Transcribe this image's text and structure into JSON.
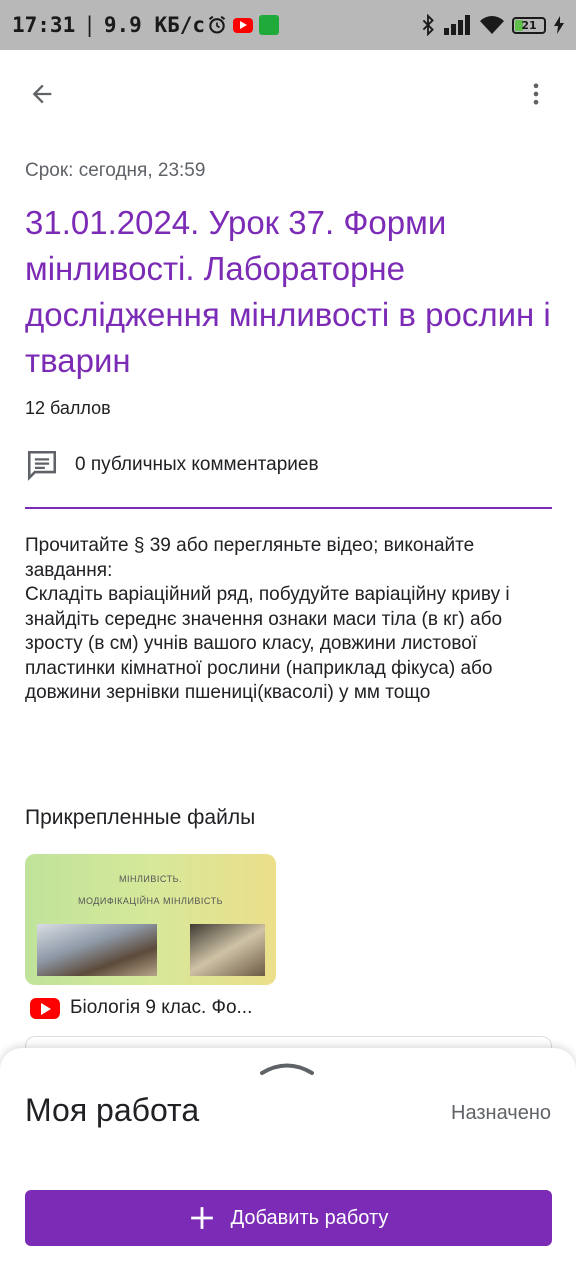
{
  "status_bar": {
    "time": "17:31",
    "separator": "|",
    "speed": "9.9 КБ/с",
    "battery_level": "21",
    "icons": [
      "alarm-icon",
      "youtube-icon",
      "fitness-icon",
      "bluetooth-icon",
      "signal-icon",
      "wifi-icon",
      "battery-icon",
      "charging-icon"
    ]
  },
  "header": {
    "back_icon": "arrow-back-icon",
    "more_icon": "more-vert-icon"
  },
  "assignment": {
    "due": "Срок: сегодня, 23:59",
    "title": "31.01.2024. Урок 37. Форми мінливості. Лабораторне дослідження мінливості в рослин і тварин",
    "points": "12 баллов",
    "comments": "0 публичных комментариев",
    "description": "Прочитайте § 39 або перегляньте відео; виконайте завдання:\nСкладіть варіаційний ряд, побудуйте варіаційну криву і знайдіть середнє значення ознаки маси тіла (в кг) або зросту (в см) учнів вашого класу, довжини листової пластинки кімнатної рослини (наприклад фікуса) або довжини зернівки пшениці(квасолі) у мм тощо"
  },
  "attachments": {
    "section_title": "Прикрепленные файлы",
    "items": [
      {
        "thumbnail_line1": "МІНЛИВІСТЬ.",
        "thumbnail_line2": "МОДИФІКАЦІЙНА МІНЛИВІСТЬ",
        "label": "Біологія 9 клас. Фо...",
        "icon": "youtube-icon"
      }
    ]
  },
  "my_work": {
    "title": "Моя работа",
    "status": "Назначено",
    "add_button": "Добавить работу"
  },
  "colors": {
    "accent": "#7b2bb5",
    "status_bar": "#b8b8b8"
  }
}
